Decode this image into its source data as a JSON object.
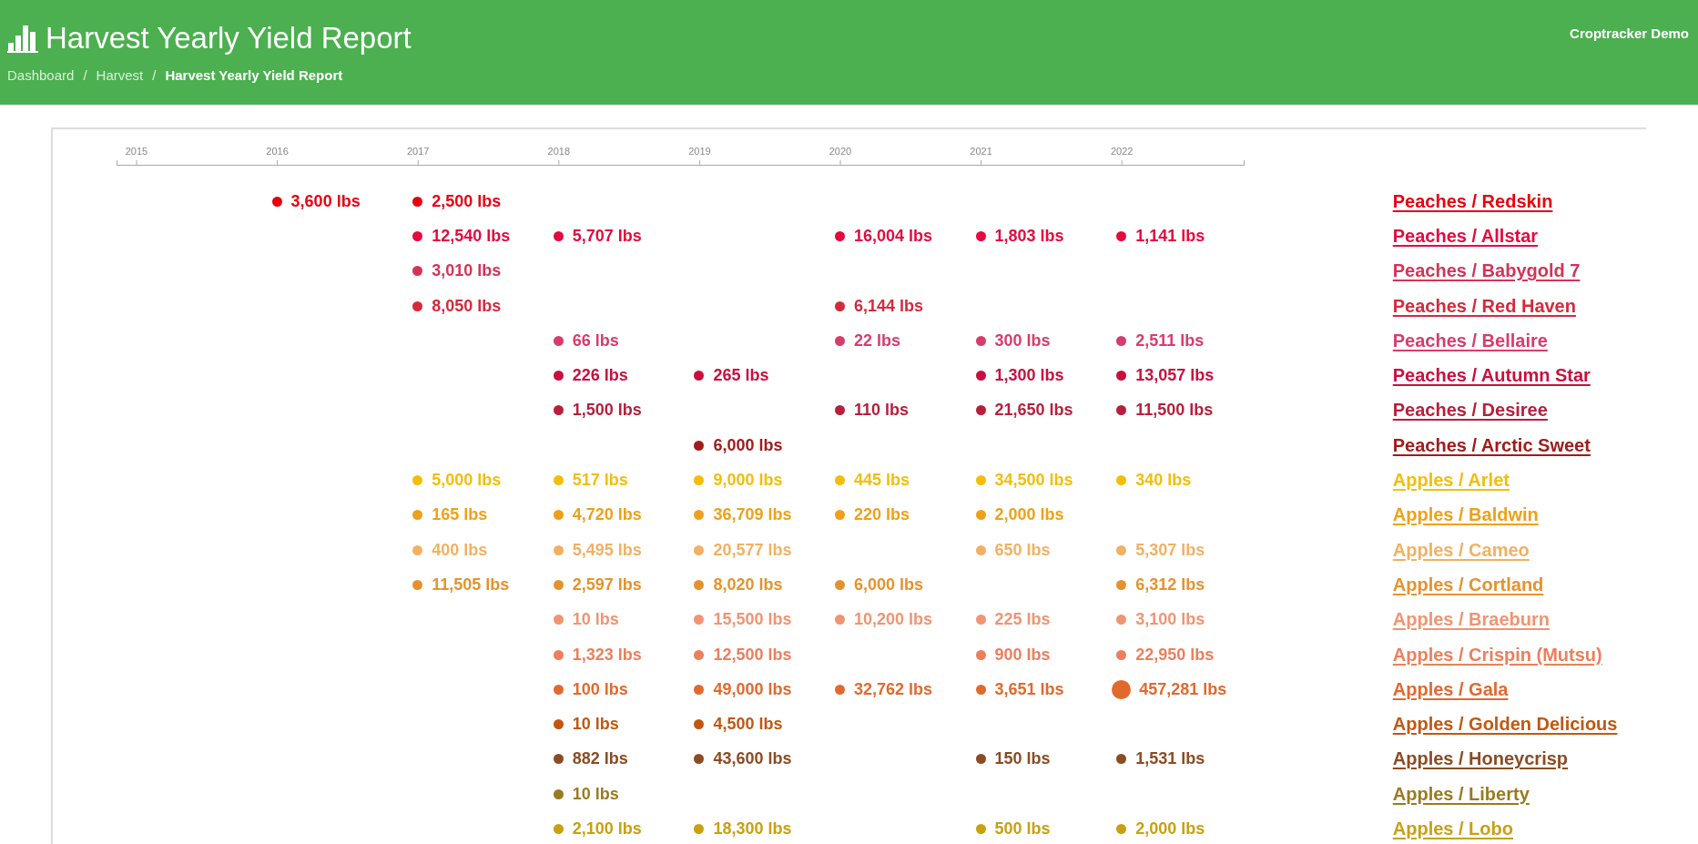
{
  "header": {
    "title": "Harvest Yearly Yield Report",
    "account": "Croptracker Demo",
    "breadcrumbs": [
      {
        "label": "Dashboard",
        "current": false
      },
      {
        "label": "Harvest",
        "current": false
      },
      {
        "label": "Harvest Yearly Yield Report",
        "current": true
      }
    ],
    "separator": "/"
  },
  "timeline": {
    "years": [
      "2015",
      "2016",
      "2017",
      "2018",
      "2019",
      "2020",
      "2021",
      "2022"
    ],
    "rows": [
      {
        "name": "Peaches / Redskin",
        "color": "#e8000f",
        "cells": [
          null,
          {
            "value": "3,600 lbs",
            "large": false
          },
          {
            "value": "2,500 lbs",
            "large": false
          },
          null,
          null,
          null,
          null,
          null
        ]
      },
      {
        "name": "Peaches / Allstar",
        "color": "#e40a3e",
        "cells": [
          null,
          null,
          {
            "value": "12,540 lbs",
            "large": false
          },
          {
            "value": "5,707 lbs",
            "large": false
          },
          null,
          {
            "value": "16,004 lbs",
            "large": false
          },
          {
            "value": "1,803 lbs",
            "large": false
          },
          {
            "value": "1,141 lbs",
            "large": false
          }
        ]
      },
      {
        "name": "Peaches / Babygold 7",
        "color": "#d33456",
        "cells": [
          null,
          null,
          {
            "value": "3,010 lbs",
            "large": false
          },
          null,
          null,
          null,
          null,
          null
        ]
      },
      {
        "name": "Peaches / Red Haven",
        "color": "#d42a3c",
        "cells": [
          null,
          null,
          {
            "value": "8,050 lbs",
            "large": false
          },
          null,
          null,
          {
            "value": "6,144 lbs",
            "large": false
          },
          null,
          null
        ]
      },
      {
        "name": "Peaches / Bellaire",
        "color": "#d63d6c",
        "cells": [
          null,
          null,
          null,
          {
            "value": "66 lbs",
            "large": false
          },
          null,
          {
            "value": "22 lbs",
            "large": false
          },
          {
            "value": "300 lbs",
            "large": false
          },
          {
            "value": "2,511 lbs",
            "large": false
          }
        ]
      },
      {
        "name": "Peaches / Autumn Star",
        "color": "#c8103e",
        "cells": [
          null,
          null,
          null,
          {
            "value": "226 lbs",
            "large": false
          },
          {
            "value": "265 lbs",
            "large": false
          },
          null,
          {
            "value": "1,300 lbs",
            "large": false
          },
          {
            "value": "13,057 lbs",
            "large": false
          }
        ]
      },
      {
        "name": "Peaches / Desiree",
        "color": "#b71f3c",
        "cells": [
          null,
          null,
          null,
          {
            "value": "1,500 lbs",
            "large": false
          },
          null,
          {
            "value": "110 lbs",
            "large": false
          },
          {
            "value": "21,650 lbs",
            "large": false
          },
          {
            "value": "11,500 lbs",
            "large": false
          }
        ]
      },
      {
        "name": "Peaches / Arctic Sweet",
        "color": "#a01c1c",
        "cells": [
          null,
          null,
          null,
          null,
          {
            "value": "6,000 lbs",
            "large": false
          },
          null,
          null,
          null
        ]
      },
      {
        "name": "Apples / Arlet",
        "color": "#f2be0a",
        "cells": [
          null,
          null,
          {
            "value": "5,000 lbs",
            "large": false
          },
          {
            "value": "517 lbs",
            "large": false
          },
          {
            "value": "9,000 lbs",
            "large": false
          },
          {
            "value": "445 lbs",
            "large": false
          },
          {
            "value": "34,500 lbs",
            "large": false
          },
          {
            "value": "340 lbs",
            "large": false
          }
        ]
      },
      {
        "name": "Apples / Baldwin",
        "color": "#eea118",
        "cells": [
          null,
          null,
          {
            "value": "165 lbs",
            "large": false
          },
          {
            "value": "4,720 lbs",
            "large": false
          },
          {
            "value": "36,709 lbs",
            "large": false
          },
          {
            "value": "220 lbs",
            "large": false
          },
          {
            "value": "2,000 lbs",
            "large": false
          },
          null
        ]
      },
      {
        "name": "Apples / Cameo",
        "color": "#f3b062",
        "cells": [
          null,
          null,
          {
            "value": "400 lbs",
            "large": false
          },
          {
            "value": "5,495 lbs",
            "large": false
          },
          {
            "value": "20,577 lbs",
            "large": false
          },
          null,
          {
            "value": "650 lbs",
            "large": false
          },
          {
            "value": "5,307 lbs",
            "large": false
          }
        ]
      },
      {
        "name": "Apples / Cortland",
        "color": "#e6922c",
        "cells": [
          null,
          null,
          {
            "value": "11,505 lbs",
            "large": false
          },
          {
            "value": "2,597 lbs",
            "large": false
          },
          {
            "value": "8,020 lbs",
            "large": false
          },
          {
            "value": "6,000 lbs",
            "large": false
          },
          null,
          {
            "value": "6,312 lbs",
            "large": false
          }
        ]
      },
      {
        "name": "Apples / Braeburn",
        "color": "#f09472",
        "cells": [
          null,
          null,
          null,
          {
            "value": "10 lbs",
            "large": false
          },
          {
            "value": "15,500 lbs",
            "large": false
          },
          {
            "value": "10,200 lbs",
            "large": false
          },
          {
            "value": "225 lbs",
            "large": false
          },
          {
            "value": "3,100 lbs",
            "large": false
          }
        ]
      },
      {
        "name": "Apples / Crispin (Mutsu)",
        "color": "#ec7f5c",
        "cells": [
          null,
          null,
          null,
          {
            "value": "1,323 lbs",
            "large": false
          },
          {
            "value": "12,500 lbs",
            "large": false
          },
          null,
          {
            "value": "900 lbs",
            "large": false
          },
          {
            "value": "22,950 lbs",
            "large": false
          }
        ]
      },
      {
        "name": "Apples / Gala",
        "color": "#e2692e",
        "cells": [
          null,
          null,
          null,
          {
            "value": "100 lbs",
            "large": false
          },
          {
            "value": "49,000 lbs",
            "large": false
          },
          {
            "value": "32,762 lbs",
            "large": false
          },
          {
            "value": "3,651 lbs",
            "large": false
          },
          {
            "value": "457,281 lbs",
            "large": true
          }
        ]
      },
      {
        "name": "Apples / Golden Delicious",
        "color": "#c05812",
        "cells": [
          null,
          null,
          null,
          {
            "value": "10 lbs",
            "large": false
          },
          {
            "value": "4,500 lbs",
            "large": false
          },
          null,
          null,
          null
        ]
      },
      {
        "name": "Apples / Honeycrisp",
        "color": "#8c4b22",
        "cells": [
          null,
          null,
          null,
          {
            "value": "882 lbs",
            "large": false
          },
          {
            "value": "43,600 lbs",
            "large": false
          },
          null,
          {
            "value": "150 lbs",
            "large": false
          },
          {
            "value": "1,531 lbs",
            "large": false
          }
        ]
      },
      {
        "name": "Apples / Liberty",
        "color": "#9a7a22",
        "cells": [
          null,
          null,
          null,
          {
            "value": "10 lbs",
            "large": false
          },
          null,
          null,
          null,
          null
        ]
      },
      {
        "name": "Apples / Lobo",
        "color": "#c8a012",
        "cells": [
          null,
          null,
          null,
          {
            "value": "2,100 lbs",
            "large": false
          },
          {
            "value": "18,300 lbs",
            "large": false
          },
          null,
          {
            "value": "500 lbs",
            "large": false
          },
          {
            "value": "2,000 lbs",
            "large": false
          }
        ]
      }
    ]
  }
}
